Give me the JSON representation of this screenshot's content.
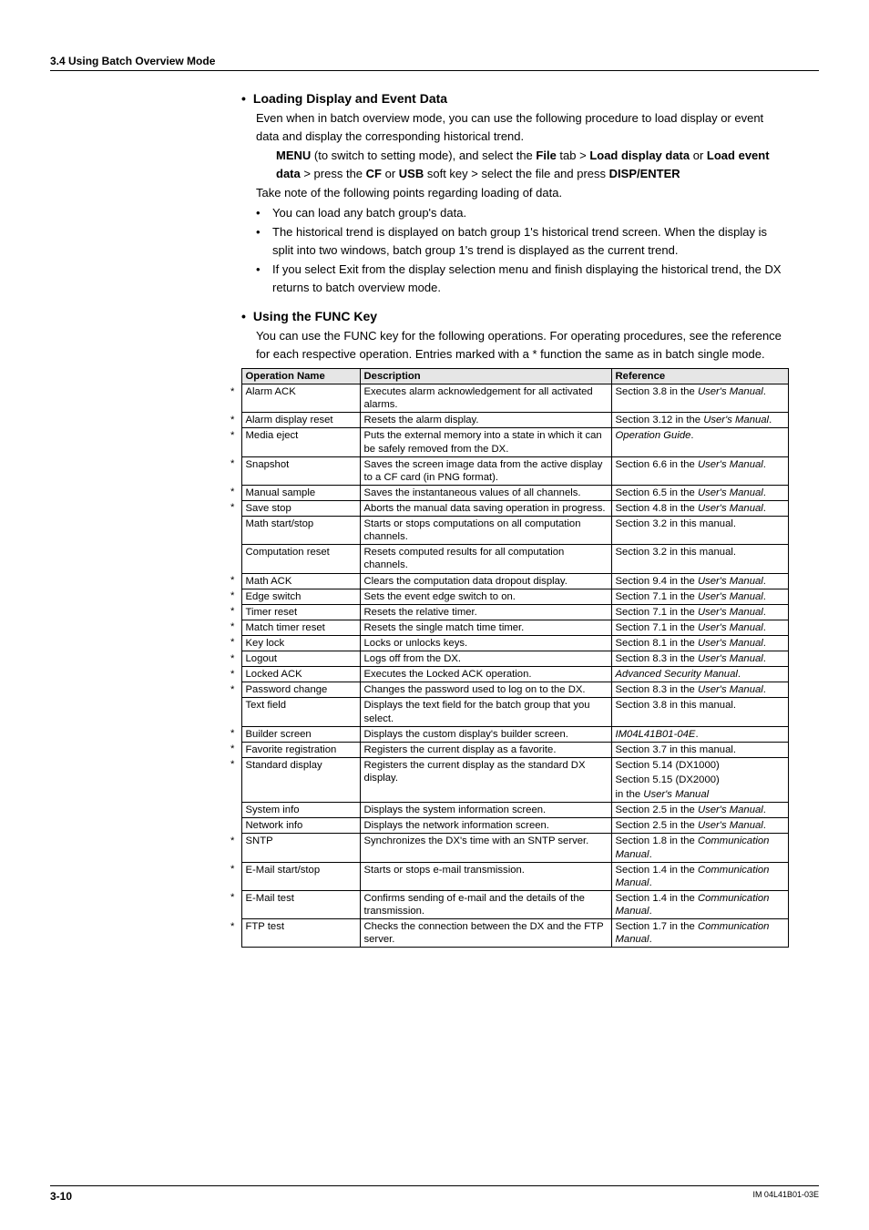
{
  "header": {
    "section": "3.4  Using Batch Overview Mode"
  },
  "loading": {
    "title": "Loading Display and Event Data",
    "p1": "Even when in batch overview mode, you can use the following procedure to load display or event data and display the corresponding historical trend.",
    "menu_a": "MENU",
    "menu_b": " (to switch to setting mode), and select the ",
    "menu_c": "File",
    "menu_d": " tab > ",
    "menu_e": "Load display data",
    "menu_f": " or ",
    "menu_g": "Load event data",
    "menu_h": " > press the ",
    "menu_i": "CF",
    "menu_j": " or ",
    "menu_k": "USB",
    "menu_l": " soft key > select the file and press ",
    "menu_m": "DISP/ENTER",
    "p2": "Take note of the following points regarding loading of data.",
    "bullets": [
      "You can load any batch group's data.",
      "The historical trend is displayed on batch group 1's historical trend screen. When the display is split into two windows, batch group 1's trend is displayed as the current trend.",
      "If you select Exit from the display selection menu and finish displaying the historical trend, the DX returns to batch overview mode."
    ]
  },
  "func": {
    "title": "Using the FUNC Key",
    "p1": "You can use the FUNC key for the following operations. For operating procedures, see the reference for each respective operation. Entries marked with a * function the same as in batch single mode."
  },
  "table": {
    "headers": [
      "Operation Name",
      "Description",
      "Reference"
    ],
    "rows": [
      {
        "star": "*",
        "op": "Alarm ACK",
        "desc": "Executes alarm acknowledgement for all activated alarms.",
        "ref": [
          "Section 3.8 in the ",
          "User's Manual",
          "."
        ]
      },
      {
        "star": "*",
        "op": "Alarm display reset",
        "desc": "Resets the alarm display.",
        "ref": [
          "Section 3.12 in the ",
          "User's Manual",
          "."
        ]
      },
      {
        "star": "*",
        "op": "Media eject",
        "desc": "Puts the external memory into a state in which it can be safely removed from the DX.",
        "ref": [
          "",
          "Operation Guide",
          "."
        ]
      },
      {
        "star": "*",
        "op": "Snapshot",
        "desc": "Saves the screen image data from the active display to a CF card (in PNG format).",
        "ref": [
          "Section 6.6 in the ",
          "User's Manual",
          "."
        ]
      },
      {
        "star": "*",
        "op": "Manual sample",
        "desc": "Saves the instantaneous values of all channels.",
        "ref": [
          "Section 6.5 in the ",
          "User's Manual",
          "."
        ]
      },
      {
        "star": "*",
        "op": "Save stop",
        "desc": "Aborts the manual data saving operation in progress.",
        "ref": [
          "Section 4.8 in the ",
          "User's Manual",
          "."
        ]
      },
      {
        "star": "",
        "op": "Math start/stop",
        "desc": "Starts or stops computations on all computation channels.",
        "ref": [
          "Section 3.2 in this manual.",
          "",
          ""
        ]
      },
      {
        "star": "",
        "op": "Computation reset",
        "desc": "Resets computed results for all computation channels.",
        "ref": [
          "Section 3.2 in this manual.",
          "",
          ""
        ]
      },
      {
        "star": "*",
        "op": "Math ACK",
        "desc": "Clears the computation data dropout display.",
        "ref": [
          "Section 9.4 in the ",
          "User's Manual",
          "."
        ]
      },
      {
        "star": "*",
        "op": "Edge switch",
        "desc": "Sets the event edge switch to on.",
        "ref": [
          "Section 7.1 in the ",
          "User's Manual",
          "."
        ]
      },
      {
        "star": "*",
        "op": "Timer reset",
        "desc": "Resets the relative timer.",
        "ref": [
          "Section 7.1 in the ",
          "User's Manual",
          "."
        ]
      },
      {
        "star": "*",
        "op": "Match timer reset",
        "desc": "Resets the single match time timer.",
        "ref": [
          "Section 7.1 in the ",
          "User's Manual",
          "."
        ]
      },
      {
        "star": "*",
        "op": "Key lock",
        "desc": "Locks or unlocks keys.",
        "ref": [
          "Section 8.1 in the ",
          "User's Manual",
          "."
        ]
      },
      {
        "star": "*",
        "op": "Logout",
        "desc": "Logs off from the DX.",
        "ref": [
          "Section 8.3 in the ",
          "User's Manual",
          "."
        ]
      },
      {
        "star": "*",
        "op": "Locked ACK",
        "desc": "Executes the Locked ACK operation.",
        "ref": [
          "",
          "Advanced Security Manual",
          "."
        ]
      },
      {
        "star": "*",
        "op": "Password change",
        "desc": "Changes the password used to log on to the DX.",
        "ref": [
          "Section 8.3 in the ",
          "User's Manual",
          "."
        ]
      },
      {
        "star": "",
        "op": "Text field",
        "desc": "Displays the text field for the batch group that you select.",
        "ref": [
          "Section 3.8 in this manual.",
          "",
          ""
        ]
      },
      {
        "star": "*",
        "op": "Builder screen",
        "desc": "Displays the custom display's builder screen.",
        "ref": [
          "",
          "IM04L41B01-04E",
          "."
        ]
      },
      {
        "star": "*",
        "op": "Favorite registration",
        "desc": "Registers the current display as a favorite.",
        "ref": [
          "Section 3.7 in this manual.",
          "",
          ""
        ]
      },
      {
        "star": "*",
        "op": "Standard display",
        "desc": "Registers the current display as the standard DX display.",
        "ref": [
          "__STD__",
          "",
          ""
        ]
      },
      {
        "star": "",
        "op": "System info",
        "desc": "Displays the system information screen.",
        "ref": [
          "Section 2.5 in the ",
          "User's Manual",
          "."
        ]
      },
      {
        "star": "",
        "op": "Network info",
        "desc": "Displays the network information screen.",
        "ref": [
          "Section 2.5 in the ",
          "User's Manual",
          "."
        ]
      },
      {
        "star": "*",
        "op": "SNTP",
        "desc": "Synchronizes the DX's time with an SNTP server.",
        "ref": [
          "Section 1.8 in the ",
          "Communication Manual",
          "."
        ]
      },
      {
        "star": "*",
        "op": "E-Mail start/stop",
        "desc": "Starts or stops e-mail transmission.",
        "ref": [
          "Section 1.4 in the ",
          "Communication Manual",
          "."
        ]
      },
      {
        "star": "*",
        "op": "E-Mail test",
        "desc": "Confirms sending of e-mail and the details of the transmission.",
        "ref": [
          "Section 1.4 in the ",
          "Communication Manual",
          "."
        ]
      },
      {
        "star": "*",
        "op": "FTP test",
        "desc": "Checks the connection between the DX and the FTP server.",
        "ref": [
          "Section 1.7 in the ",
          "Communication Manual",
          "."
        ]
      }
    ],
    "std_ref": {
      "a": "Section 5.14 (DX1000)",
      "b": "Section 5.15 (DX2000)",
      "c_pre": "in the ",
      "c_it": "User's Manual"
    }
  },
  "footer": {
    "page": "3-10",
    "doc": "IM 04L41B01-03E"
  }
}
